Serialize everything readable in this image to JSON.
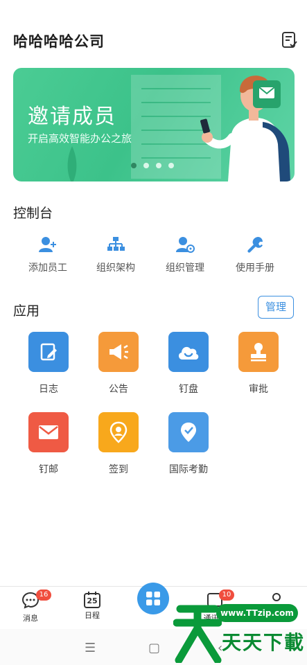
{
  "header": {
    "title": "哈哈哈哈公司",
    "icon": "checklist-icon"
  },
  "banner": {
    "title": "邀请成员",
    "subtitle": "开启高效智能办公之旅",
    "dots": 4,
    "active_dot": 0
  },
  "console": {
    "title": "控制台",
    "items": [
      {
        "label": "添加员工",
        "icon": "add-user-icon"
      },
      {
        "label": "组织架构",
        "icon": "org-chart-icon"
      },
      {
        "label": "组织管理",
        "icon": "user-settings-icon"
      },
      {
        "label": "使用手册",
        "icon": "wrench-icon"
      }
    ]
  },
  "apps": {
    "title": "应用",
    "manage_label": "管理",
    "items": [
      {
        "label": "日志",
        "icon": "note-edit-icon",
        "color": "#3b8fe0"
      },
      {
        "label": "公告",
        "icon": "megaphone-icon",
        "color": "#f59a3a"
      },
      {
        "label": "钉盘",
        "icon": "cloud-icon",
        "color": "#3b8fe0"
      },
      {
        "label": "审批",
        "icon": "stamp-icon",
        "color": "#f59a3a"
      },
      {
        "label": "钉邮",
        "icon": "mail-icon",
        "color": "#ef5a44"
      },
      {
        "label": "签到",
        "icon": "location-pin-icon",
        "color": "#f8a81c"
      },
      {
        "label": "国际考勤",
        "icon": "check-pin-icon",
        "color": "#4b9be6"
      }
    ]
  },
  "tabbar": {
    "tabs": [
      {
        "label": "消息",
        "badge": "16",
        "icon": "chat-icon"
      },
      {
        "label": "日程",
        "date": "25",
        "icon": "calendar-icon"
      },
      {
        "label": "",
        "icon": "apps-grid-icon"
      },
      {
        "label": "通讯录",
        "badge": "10",
        "icon": "contacts-icon"
      },
      {
        "label": "我的",
        "icon": "profile-icon"
      }
    ]
  },
  "system_nav": {
    "menu": "☰",
    "home": "▢",
    "back": "‹"
  },
  "watermark": {
    "url": "www.TTzip.com",
    "text": "天天下載"
  }
}
